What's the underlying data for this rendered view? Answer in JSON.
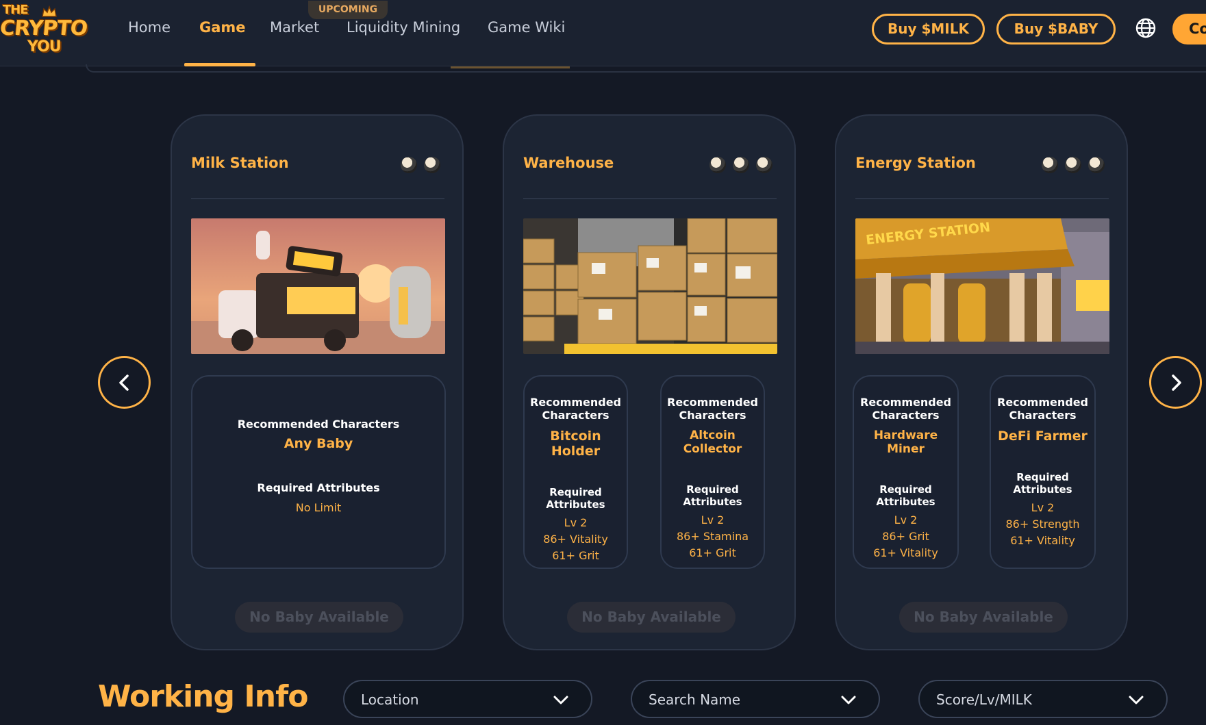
{
  "brand": {
    "logo_top": "THE",
    "logo_middle": "CRYPTO",
    "logo_bottom": "YOU"
  },
  "nav": {
    "items": [
      {
        "label": "Home"
      },
      {
        "label": "Game",
        "active": true
      },
      {
        "label": "Market"
      },
      {
        "label": "Liquidity Mining"
      },
      {
        "label": "Game Wiki"
      }
    ],
    "upcoming_badge": "UPCOMING"
  },
  "header_actions": {
    "buy_milk": "Buy $MILK",
    "buy_baby": "Buy $BABY",
    "globe_icon": "globe-icon",
    "connect_partial": "Co"
  },
  "cards": [
    {
      "title": "Milk Station",
      "baby_slots": 2,
      "image": "milk-truck-illustration",
      "requirements": [
        {
          "rec_label": "Recommended Characters",
          "character": "Any Baby",
          "req_label": "Required Attributes",
          "attributes": [
            "No Limit"
          ]
        }
      ],
      "button": "No Baby Available"
    },
    {
      "title": "Warehouse",
      "baby_slots": 3,
      "image": "warehouse-boxes-illustration",
      "requirements": [
        {
          "rec_label": "Recommended Characters",
          "character": "Bitcoin Holder",
          "req_label": "Required Attributes",
          "attributes": [
            "Lv 2",
            "86+ Vitality",
            "61+ Grit"
          ]
        },
        {
          "rec_label": "Recommended Characters",
          "character": "Altcoin Collector",
          "req_label": "Required Attributes",
          "attributes": [
            "Lv 2",
            "86+ Stamina",
            "61+ Grit"
          ]
        }
      ],
      "button": "No Baby Available"
    },
    {
      "title": "Energy Station",
      "baby_slots": 3,
      "image": "energy-station-illustration",
      "image_sign": "ENERGY STATION",
      "requirements": [
        {
          "rec_label": "Recommended Characters",
          "character": "Hardware Miner",
          "req_label": "Required Attributes",
          "attributes": [
            "Lv 2",
            "86+ Grit",
            "61+ Vitality"
          ]
        },
        {
          "rec_label": "Recommended Characters",
          "character": "DeFi Farmer",
          "req_label": "Required Attributes",
          "attributes": [
            "Lv 2",
            "86+ Strength",
            "61+ Vitality"
          ]
        }
      ],
      "button": "No Baby Available"
    }
  ],
  "carousel": {
    "prev_icon": "chevron-left-icon",
    "next_icon": "chevron-right-icon"
  },
  "working_info": {
    "title": "Working Info",
    "filters": [
      {
        "label": "Location"
      },
      {
        "label": "Search Name"
      },
      {
        "label": "Score/Lv/MILK"
      }
    ]
  },
  "colors": {
    "accent": "#ffb347",
    "background": "#141925",
    "card": "#1c2433",
    "header": "#1b2230"
  }
}
